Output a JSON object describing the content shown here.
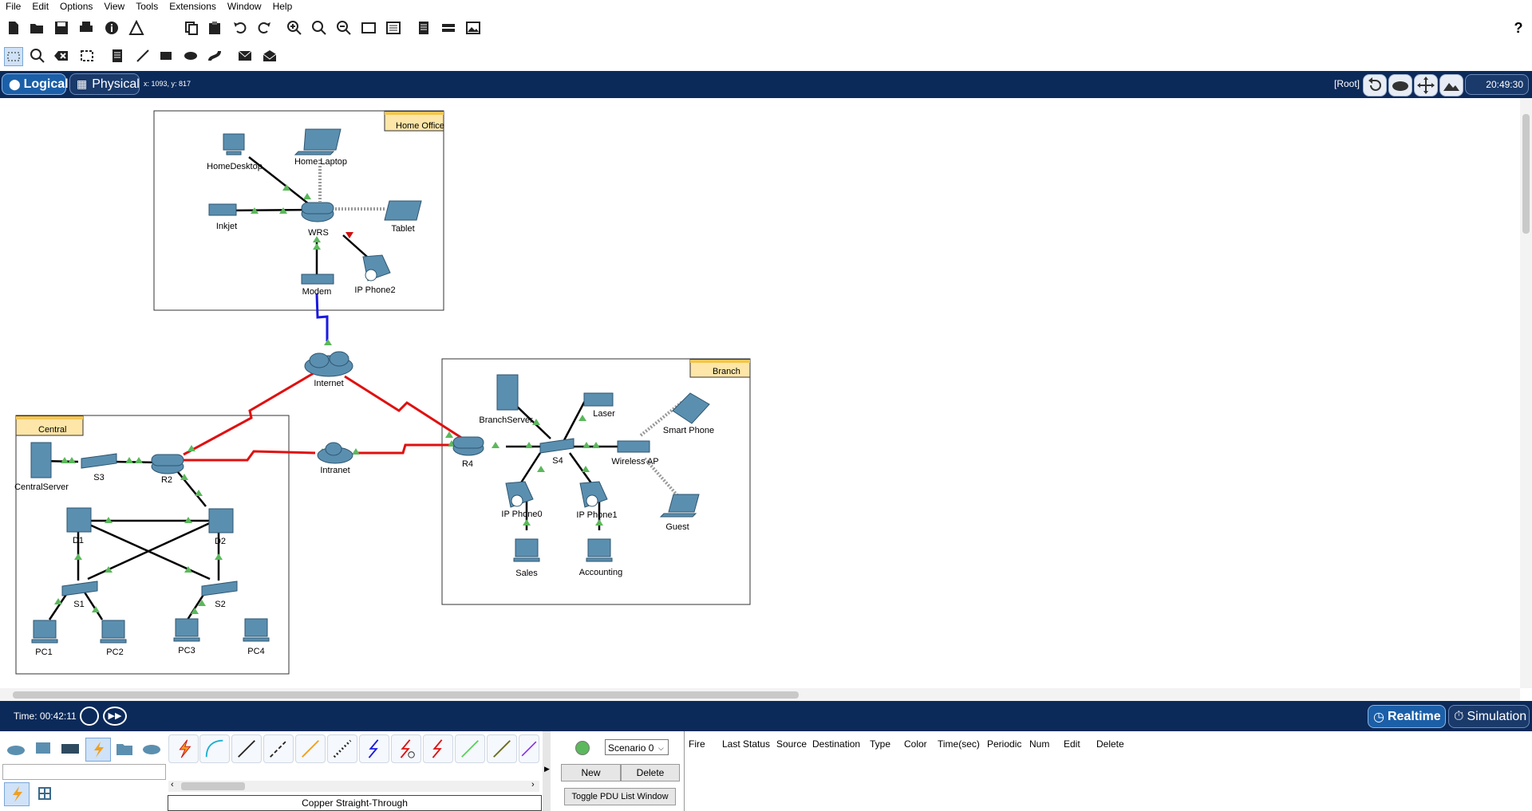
{
  "menu": [
    "File",
    "Edit",
    "Options",
    "View",
    "Tools",
    "Extensions",
    "Window",
    "Help"
  ],
  "toolbar": {
    "help_label": "?"
  },
  "viewbar": {
    "logical_label": "Logical",
    "physical_label": "Physical",
    "coordinates": "x: 1093, y: 817",
    "root_label": "[Root]",
    "clock": "20:49:30"
  },
  "clusters": {
    "home_office": "Home Office",
    "branch": "Branch",
    "central": "Central"
  },
  "devices": {
    "home_desktop": "HomeDesktop",
    "home_laptop": "Home Laptop",
    "inkjet": "Inkjet",
    "wrs": "WRS",
    "tablet": "Tablet",
    "modem": "Modem",
    "ip_phone2": "IP Phone2",
    "internet": "Internet",
    "intranet": "Intranet",
    "central_server": "CentralServer",
    "s3": "S3",
    "r2": "R2",
    "d1": "D1",
    "d2": "D2",
    "s1": "S1",
    "s2": "S2",
    "pc1": "PC1",
    "pc2": "PC2",
    "pc3": "PC3",
    "pc4": "PC4",
    "branch_server": "BranchServer",
    "laser": "Laser",
    "smart_phone": "Smart Phone",
    "r4": "R4",
    "s4": "S4",
    "wireless_ap": "Wireless AP",
    "ip_phone0": "IP Phone0",
    "ip_phone1": "IP Phone1",
    "guest": "Guest",
    "sales": "Sales",
    "accounting": "Accounting"
  },
  "timebar": {
    "time": "Time: 00:42:11",
    "realtime_label": "Realtime",
    "simulation_label": "Simulation"
  },
  "bottom": {
    "cable_name": "Copper Straight-Through",
    "scenario": "Scenario 0",
    "new_label": "New",
    "delete_label": "Delete",
    "toggle_label": "Toggle PDU List Window",
    "columns": [
      "Fire",
      "Last Status",
      "Source",
      "Destination",
      "Type",
      "Color",
      "Time(sec)",
      "Periodic",
      "Num",
      "Edit",
      "Delete"
    ]
  },
  "colors": {
    "bar": "#0b2a5a",
    "link_red": "#e01010",
    "link_blue": "#1a1ae0",
    "indicator": "#5cb85c",
    "cluster_tab": "#fde6a8"
  }
}
